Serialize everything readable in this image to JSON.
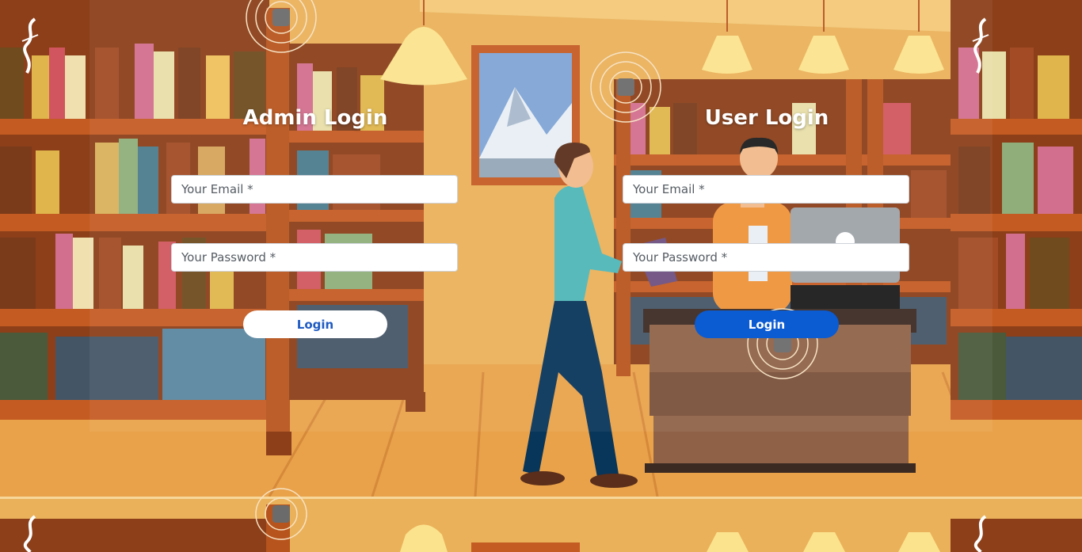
{
  "admin": {
    "title": "Admin Login",
    "email_placeholder": "Your Email *",
    "password_placeholder": "Your Password *",
    "login_label": "Login"
  },
  "user": {
    "title": "User Login",
    "email_placeholder": "Your Email *",
    "password_placeholder": "Your Password *",
    "login_label": "Login"
  },
  "icons": {
    "brand_logo": "stylized-s-logo-icon",
    "wifi_badge": "rfid-signal-icon"
  },
  "colors": {
    "wall": "#eab15a",
    "floor": "#e9a24a",
    "shelf": "#b5571f",
    "user_login_button": "#0b5bd3",
    "admin_login_text": "#1f5bc2"
  }
}
